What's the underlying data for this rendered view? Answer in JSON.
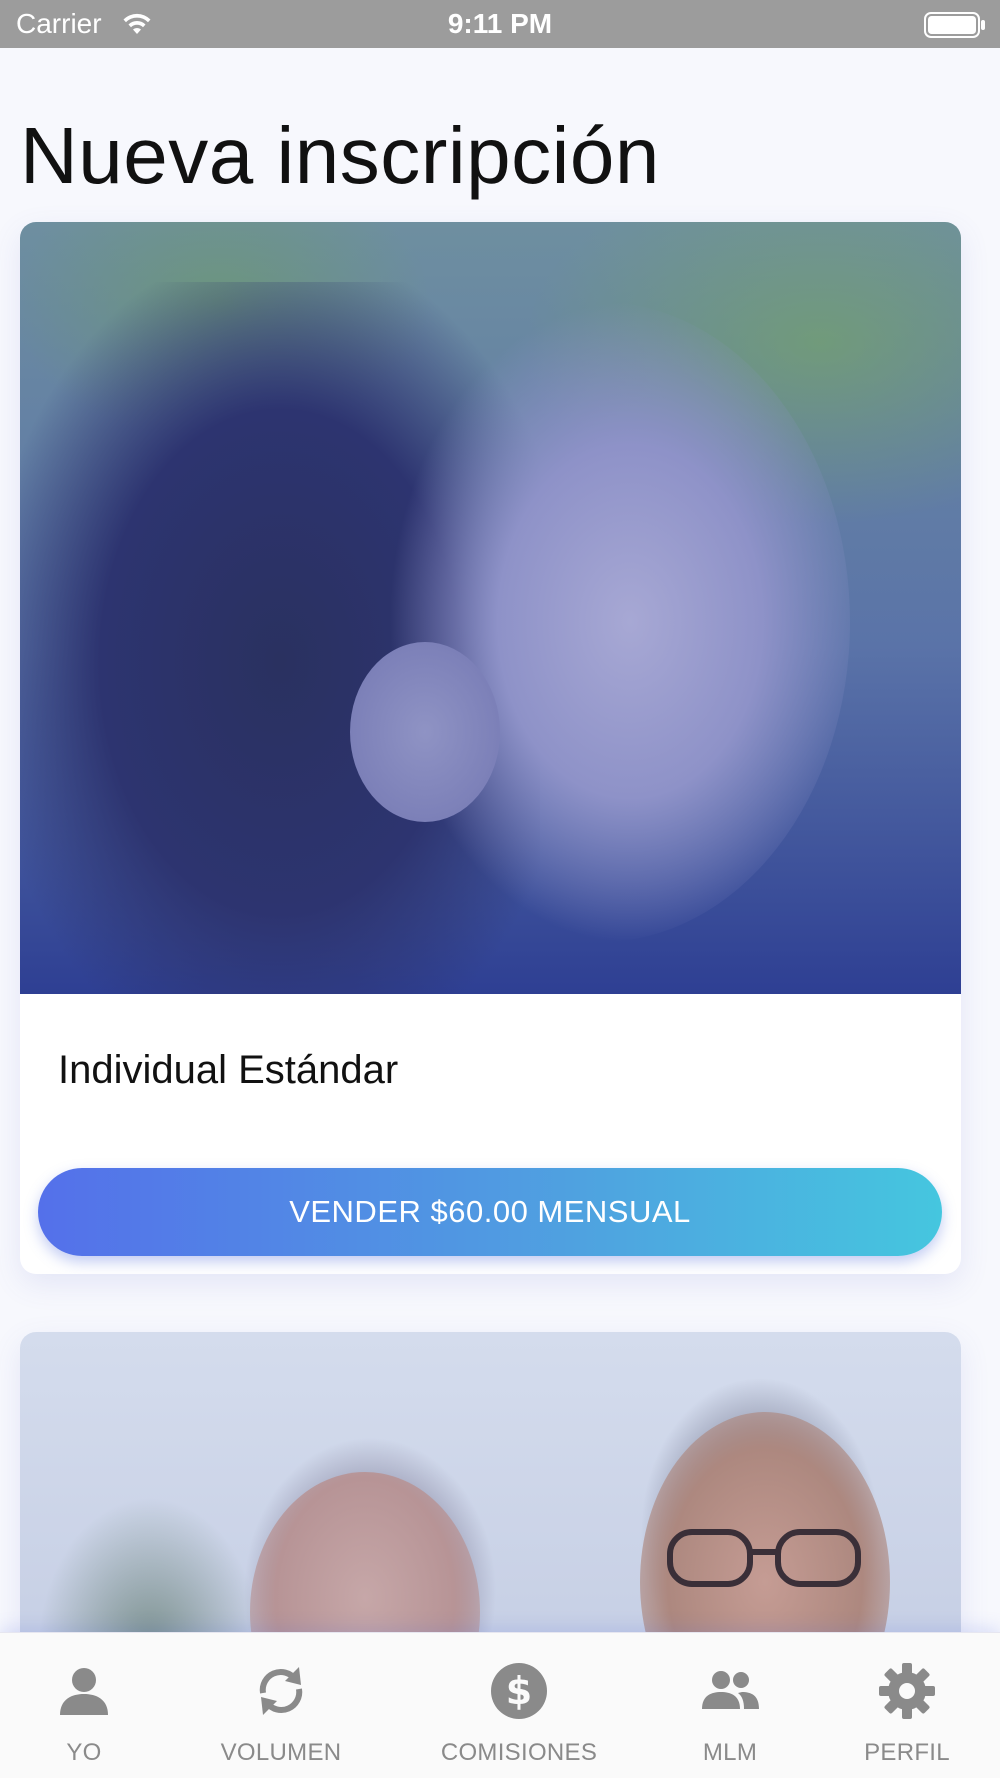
{
  "status_bar": {
    "carrier": "Carrier",
    "time": "9:11 PM",
    "icons": [
      "wifi-icon",
      "battery-icon"
    ]
  },
  "page": {
    "title": "Nueva inscripción"
  },
  "plans": [
    {
      "name": "Individual Estándar",
      "button_label": "VENDER $60.00 MENSUAL",
      "image": "woman-breathing-photo"
    },
    {
      "name": "",
      "image": "couple-photo"
    }
  ],
  "colors": {
    "button_gradient_start": "#5470ea",
    "button_gradient_end": "#45c6df",
    "tab_inactive": "#8a8a8a",
    "background": "#f7f8fd"
  },
  "tab_bar": {
    "items": [
      {
        "label": "YO",
        "icon": "person-icon"
      },
      {
        "label": "VOLUMEN",
        "icon": "refresh-icon"
      },
      {
        "label": "COMISIONES",
        "icon": "dollar-circle-icon"
      },
      {
        "label": "MLM",
        "icon": "group-icon"
      },
      {
        "label": "PERFIL",
        "icon": "gear-icon"
      }
    ]
  }
}
